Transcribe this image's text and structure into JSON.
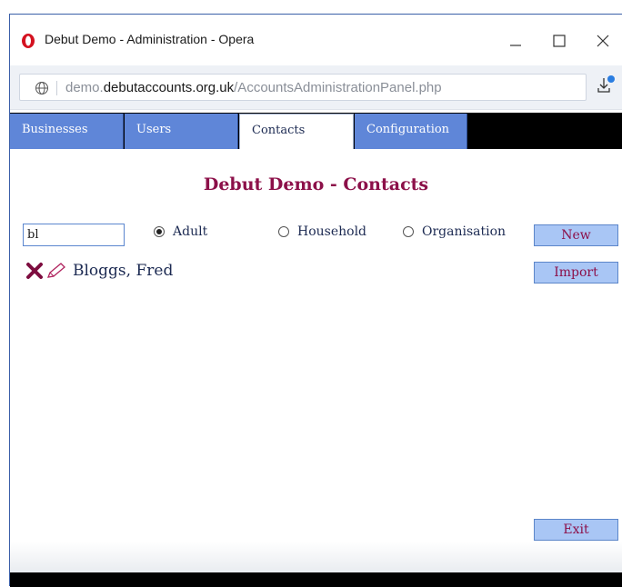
{
  "window": {
    "title": "Debut Demo - Administration - Opera",
    "minimize_label": "—",
    "maximize_label": "☐",
    "close_label": "✕"
  },
  "address": {
    "prefix": "demo.",
    "domain": "debutaccounts.org.uk",
    "path": "/AccountsAdministrationPanel.php"
  },
  "tabs": [
    {
      "label": "Businesses",
      "active": false
    },
    {
      "label": "Users",
      "active": false
    },
    {
      "label": "Contacts",
      "active": true
    },
    {
      "label": "Configuration",
      "active": false
    }
  ],
  "page": {
    "heading": "Debut Demo - Contacts"
  },
  "filter": {
    "search_value": "bl",
    "radios": [
      {
        "label": "Adult",
        "selected": true
      },
      {
        "label": "Household",
        "selected": false
      },
      {
        "label": "Organisation",
        "selected": false
      }
    ]
  },
  "buttons": {
    "new": "New",
    "import": "Import",
    "exit": "Exit"
  },
  "contacts": [
    {
      "name": "Bloggs, Fred"
    }
  ],
  "colors": {
    "accent": "#8c1049",
    "tab_blue": "#5f86d8",
    "button_blue": "#a9c6f5",
    "text_navy": "#1c2a52"
  }
}
